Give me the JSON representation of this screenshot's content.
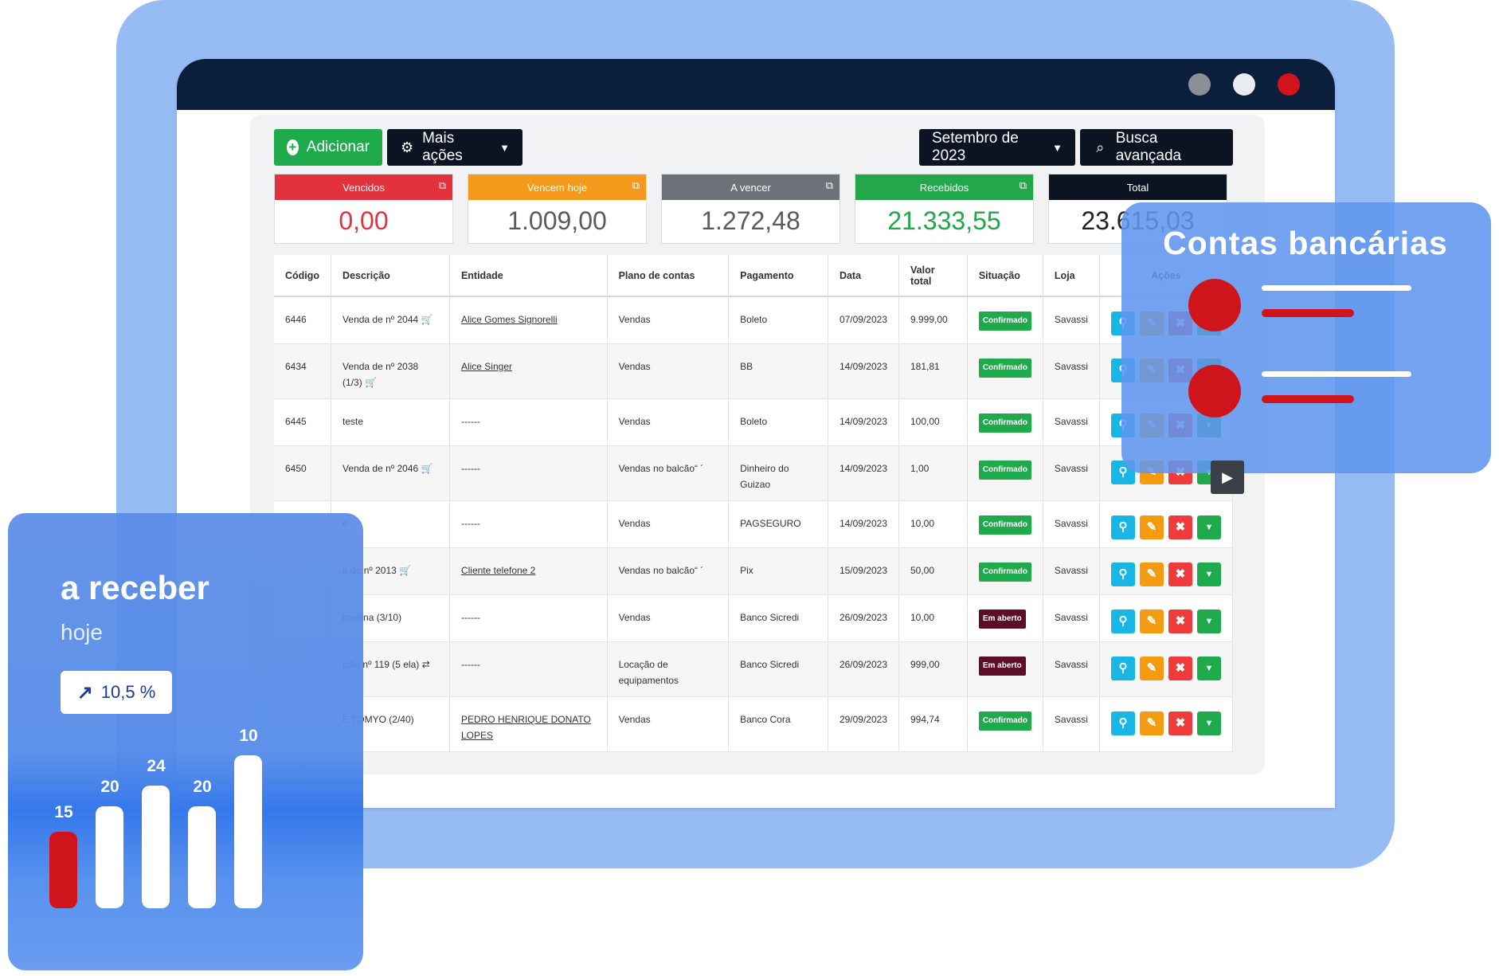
{
  "window": {
    "colors": {
      "dot1": "#8a8f98",
      "dot2": "#e8ecf1",
      "dot3": "#d0141c"
    }
  },
  "toolbar": {
    "add_label": "Adicionar",
    "more_label": "Mais ações",
    "month_label": "Setembro de 2023",
    "search_label": "Busca avançada"
  },
  "cards": [
    {
      "label": "Vencidos",
      "value": "0,00",
      "color": "#e2323e",
      "value_color": "#e2323e"
    },
    {
      "label": "Vencem hoje",
      "value": "1.009,00",
      "color": "#f39a1d",
      "value_color": "#5b5b5b"
    },
    {
      "label": "A vencer",
      "value": "1.272,48",
      "color": "#6c7278",
      "value_color": "#5b5b5b"
    },
    {
      "label": "Recebidos",
      "value": "21.333,55",
      "color": "#22a74a",
      "value_color": "#22a74a"
    },
    {
      "label": "Total",
      "value": "23.615,03",
      "color": "#0c1424",
      "value_color": "#222"
    }
  ],
  "table": {
    "headers": [
      "Código",
      "Descrição",
      "Entidade",
      "Plano de contas",
      "Pagamento",
      "Data",
      "Valor total",
      "Situação",
      "Loja",
      "Ações"
    ],
    "rows": [
      {
        "codigo": "6446",
        "descricao": "Venda de nº 2044 🛒",
        "entidade": "Alice Gomes Signorelli",
        "plano": "Vendas",
        "pagamento": "Boleto",
        "data": "07/09/2023",
        "valor": "9.999,00",
        "situacao": "Confirmado",
        "loja": "Savassi"
      },
      {
        "codigo": "6434",
        "descricao": "Venda de nº 2038 (1/3) 🛒",
        "entidade": "Alice Singer",
        "plano": "Vendas",
        "pagamento": "BB",
        "data": "14/09/2023",
        "valor": "181,81",
        "situacao": "Confirmado",
        "loja": "Savassi"
      },
      {
        "codigo": "6445",
        "descricao": "teste",
        "entidade": "------",
        "plano": "Vendas",
        "pagamento": "Boleto",
        "data": "14/09/2023",
        "valor": "100,00",
        "situacao": "Confirmado",
        "loja": "Savassi"
      },
      {
        "codigo": "6450",
        "descricao": "Venda de nº 2046 🛒",
        "entidade": "------",
        "plano": "Vendas no balcão“ ´",
        "pagamento": "Dinheiro do Guizao",
        "data": "14/09/2023",
        "valor": "1,00",
        "situacao": "Confirmado",
        "loja": "Savassi"
      },
      {
        "codigo": "",
        "descricao": "e",
        "entidade": "------",
        "plano": "Vendas",
        "pagamento": "PAGSEGURO",
        "data": "14/09/2023",
        "valor": "10,00",
        "situacao": "Confirmado",
        "loja": "Savassi"
      },
      {
        "codigo": "",
        "descricao": "a de nº 2013 🛒",
        "entidade": "Cliente telefone 2",
        "plano": "Vendas no balcão“ ´",
        "pagamento": "Pix",
        "data": "15/09/2023",
        "valor": "50,00",
        "situacao": "Confirmado",
        "loja": "Savassi"
      },
      {
        "codigo": "",
        "descricao": "medina (3/10)",
        "entidade": "------",
        "plano": "Vendas",
        "pagamento": "Banco Sicredi",
        "data": "26/09/2023",
        "valor": "10,00",
        "situacao": "Em aberto",
        "loja": "Savassi"
      },
      {
        "codigo": "",
        "descricao": "ição nº 119 (5 ela) ⇄",
        "entidade": "------",
        "plano": "Locação de equipamentos",
        "pagamento": "Banco Sicredi",
        "data": "26/09/2023",
        "valor": "999,00",
        "situacao": "Em aberto",
        "loja": "Savassi"
      },
      {
        "codigo": "",
        "descricao": "E TOMYO (2/40)",
        "entidade": "PEDRO HENRIQUE DONATO LOPES",
        "plano": "Vendas",
        "pagamento": "Banco Cora",
        "data": "29/09/2023",
        "valor": "994,74",
        "situacao": "Confirmado",
        "loja": "Savassi"
      }
    ]
  },
  "bank_overlay": {
    "title": "Contas bancárias"
  },
  "receivable": {
    "title": "a receber",
    "subtitle": "hoje",
    "change": "10,5 %",
    "bars": [
      {
        "label": "15",
        "value": 15,
        "color": "#d0141c"
      },
      {
        "label": "20",
        "value": 20,
        "color": "#ffffff"
      },
      {
        "label": "24",
        "value": 24,
        "color": "#ffffff"
      },
      {
        "label": "20",
        "value": 20,
        "color": "#ffffff"
      },
      {
        "label": "10",
        "value": 30,
        "color": "#ffffff"
      }
    ]
  }
}
